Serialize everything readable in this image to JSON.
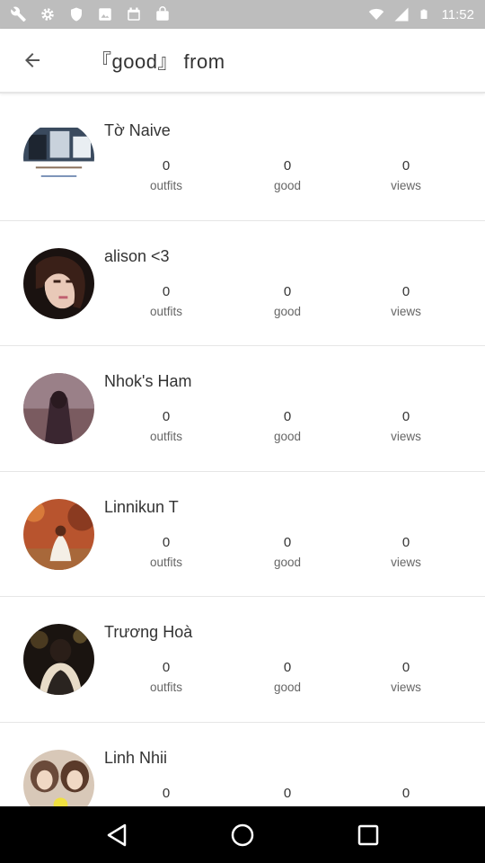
{
  "status_bar": {
    "time": "11:52",
    "left_icons": [
      "wrench-icon",
      "gear-icon",
      "shield-icon",
      "image-icon",
      "calendar-icon",
      "bag-icon"
    ],
    "right_icons": [
      "wifi-icon",
      "signal-icon",
      "battery-icon"
    ]
  },
  "header": {
    "back_icon": "arrow-back-icon",
    "title": "『good』 from"
  },
  "stat_labels": {
    "outfits": "outfits",
    "good": "good",
    "views": "views"
  },
  "users": [
    {
      "name": "Tờ Naive",
      "outfits": "0",
      "good": "0",
      "views": "0"
    },
    {
      "name": "alison <3",
      "outfits": "0",
      "good": "0",
      "views": "0"
    },
    {
      "name": "Nhok's Ham",
      "outfits": "0",
      "good": "0",
      "views": "0"
    },
    {
      "name": "Linnikun T",
      "outfits": "0",
      "good": "0",
      "views": "0"
    },
    {
      "name": "Trương Hoà",
      "outfits": "0",
      "good": "0",
      "views": "0"
    },
    {
      "name": "Linh Nhii",
      "outfits": "0",
      "good": "0",
      "views": "0"
    }
  ],
  "nav_bar": {
    "icons": [
      "back-triangle-icon",
      "home-circle-icon",
      "recents-square-icon"
    ]
  }
}
